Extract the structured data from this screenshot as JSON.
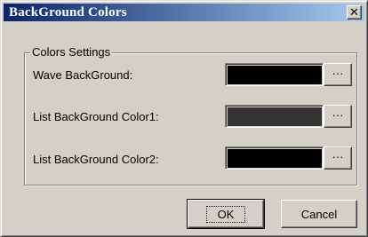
{
  "window": {
    "title": "BackGround Colors",
    "close_glyph": "✕",
    "close_icon": "close-icon"
  },
  "group": {
    "legend": "Colors Settings",
    "rows": [
      {
        "label": "Wave BackGround:",
        "color": "#000000",
        "button": "···"
      },
      {
        "label": "List BackGround Color1:",
        "color": "#333333",
        "button": "···"
      },
      {
        "label": "List BackGround Color2:",
        "color": "#000000",
        "button": "···"
      }
    ]
  },
  "buttons": {
    "ok": "OK",
    "cancel": "Cancel"
  },
  "colors": {
    "face": "#d4d0c8",
    "title_start": "#0a246a",
    "title_end": "#a6caf0"
  }
}
